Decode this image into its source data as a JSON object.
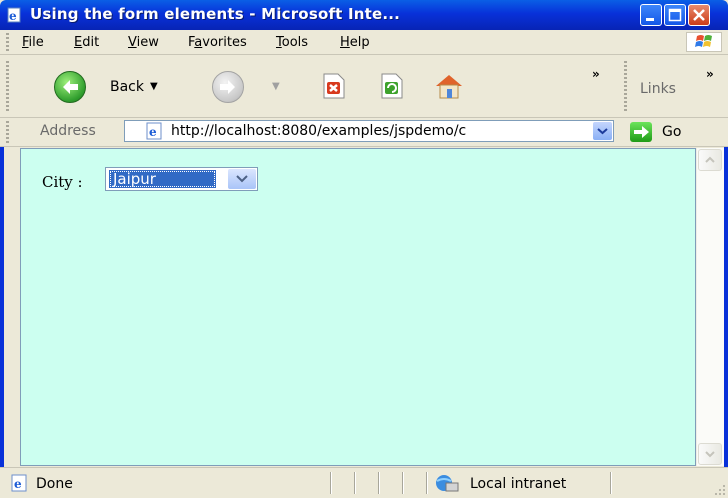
{
  "window": {
    "title": "Using the form elements - Microsoft Inte..."
  },
  "menu": {
    "items": [
      {
        "label": "File",
        "underline": "F"
      },
      {
        "label": "Edit",
        "underline": "E"
      },
      {
        "label": "View",
        "underline": "V"
      },
      {
        "label": "Favorites",
        "underline": "a"
      },
      {
        "label": "Tools",
        "underline": "T"
      },
      {
        "label": "Help",
        "underline": "H"
      }
    ]
  },
  "toolbar": {
    "back_label": "Back",
    "chevron": "»",
    "links_label": "Links",
    "icons": [
      "back-icon",
      "forward-icon",
      "stop-icon",
      "refresh-icon",
      "home-icon"
    ]
  },
  "address": {
    "label": "Address",
    "url": "http://localhost:8080/examples/jspdemo/c",
    "go_label": "Go"
  },
  "content": {
    "background": "#ccfff0",
    "city_label": "City :",
    "city_select": {
      "selected": "Jaipur"
    }
  },
  "status": {
    "text": "Done",
    "zone": "Local intranet"
  },
  "colors": {
    "titlebar": "#0831d9",
    "selection": "#316ac5",
    "chrome": "#ece9d8"
  }
}
